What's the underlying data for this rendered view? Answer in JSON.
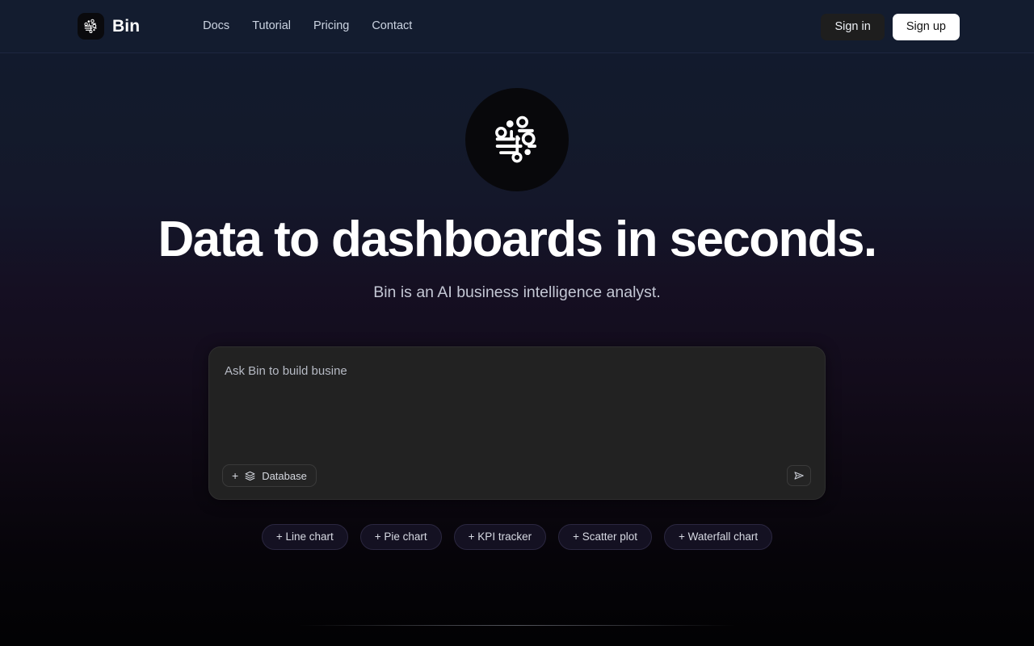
{
  "header": {
    "brand_name": "Bin",
    "brand_icon": "bin-data-circuit-logo-icon",
    "nav": [
      {
        "label": "Docs"
      },
      {
        "label": "Tutorial"
      },
      {
        "label": "Pricing"
      },
      {
        "label": "Contact"
      }
    ],
    "sign_in_label": "Sign in",
    "sign_up_label": "Sign up"
  },
  "hero": {
    "logo_icon": "bin-data-circuit-logo-icon",
    "headline": "Data to dashboards in seconds.",
    "subhead": "Bin is an AI business intelligence analyst."
  },
  "composer": {
    "placeholder": "Ask Bin to build busine",
    "value": "",
    "attach_plus_label": "+",
    "attach_icon": "database-layers-icon",
    "attach_label": "Database",
    "send_icon": "send-paper-plane-icon"
  },
  "suggestions": [
    {
      "label": "+ Line chart"
    },
    {
      "label": "+ Pie chart"
    },
    {
      "label": "+ KPI tracker"
    },
    {
      "label": "+ Scatter plot"
    },
    {
      "label": "+ Waterfall chart"
    }
  ],
  "colors": {
    "header_bg": "#131c2f",
    "page_top": "#121b2f",
    "page_mid": "#150f22",
    "page_bottom": "#020203",
    "composer_bg": "#222222",
    "chip_bg": "#141122",
    "signup_bg": "#ffffff",
    "signin_bg": "#1e1e1e",
    "text_primary": "#ffffff",
    "text_muted": "#c3c7d4"
  }
}
